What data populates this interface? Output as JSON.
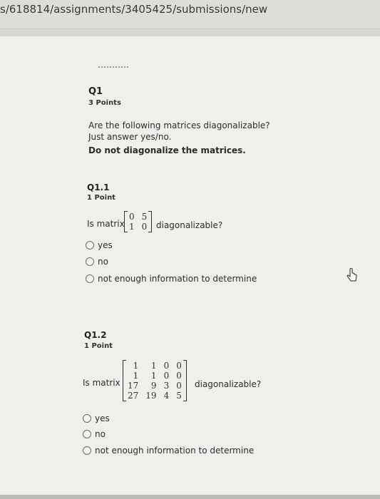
{
  "browser": {
    "url": "s/618814/assignments/3405425/submissions/new"
  },
  "q1": {
    "title": "Q1",
    "points": "3 Points",
    "prompt_line1": "Are the following matrices diagonalizable?",
    "prompt_line2": "Just answer yes/no.",
    "prompt_line3": "Do not diagonalize the matrices."
  },
  "q1_1": {
    "title": "Q1.1",
    "points": "1 Point",
    "lead": "Is matrix",
    "trail": "diagonalizable?",
    "matrix": [
      [
        "0",
        "5"
      ],
      [
        "1",
        "0"
      ]
    ],
    "options": [
      "yes",
      "no",
      "not enough information to determine"
    ]
  },
  "q1_2": {
    "title": "Q1.2",
    "points": "1 Point",
    "lead": "Is matrix",
    "trail": "diagonalizable?",
    "matrix": [
      [
        "1",
        "1",
        "0",
        "0"
      ],
      [
        "1",
        "1",
        "0",
        "0"
      ],
      [
        "17",
        "9",
        "3",
        "0"
      ],
      [
        "27",
        "19",
        "4",
        "5"
      ]
    ],
    "options": [
      "yes",
      "no",
      "not enough information to determine"
    ]
  },
  "icons": {
    "cursor": "mouse-pointer-icon",
    "radio": "radio-button-icon"
  }
}
